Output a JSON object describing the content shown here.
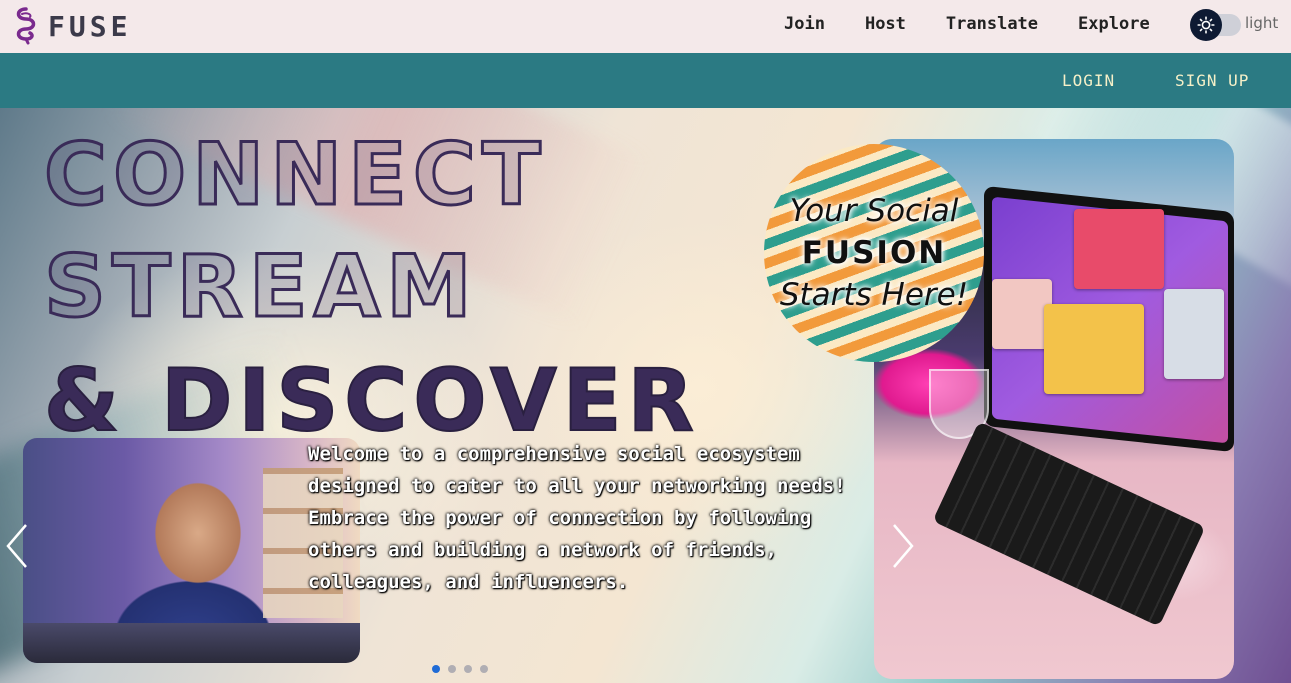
{
  "brand": {
    "name": "FUSE"
  },
  "nav": {
    "links": [
      {
        "label": "Join"
      },
      {
        "label": "Host"
      },
      {
        "label": "Translate"
      },
      {
        "label": "Explore"
      }
    ],
    "theme_label": "light"
  },
  "auth": {
    "login": "LOGIN",
    "signup": "SIGN UP"
  },
  "hero": {
    "headline": [
      "CONNECT",
      "STREAM",
      "& DISCOVER"
    ],
    "text": "Welcome to a comprehensive social ecosystem designed to cater to all your networking needs! Embrace the power of connection by following others and building a network of friends, colleagues, and influencers.",
    "badge": [
      "Your Social",
      "FUSION",
      "Starts Here!"
    ],
    "carousel": {
      "slide_count": 4,
      "active_index": 0
    }
  },
  "colors": {
    "topnav_bg": "#f4e9ea",
    "authbar_bg": "#2b7a83",
    "auth_text": "#f6f0c8",
    "headline": "#3a2b58",
    "dot_active": "#1f6bd6"
  },
  "icons": {
    "logo": "fuse-logo-icon",
    "theme": "sun-icon",
    "prev": "chevron-left-icon",
    "next": "chevron-right-icon"
  }
}
